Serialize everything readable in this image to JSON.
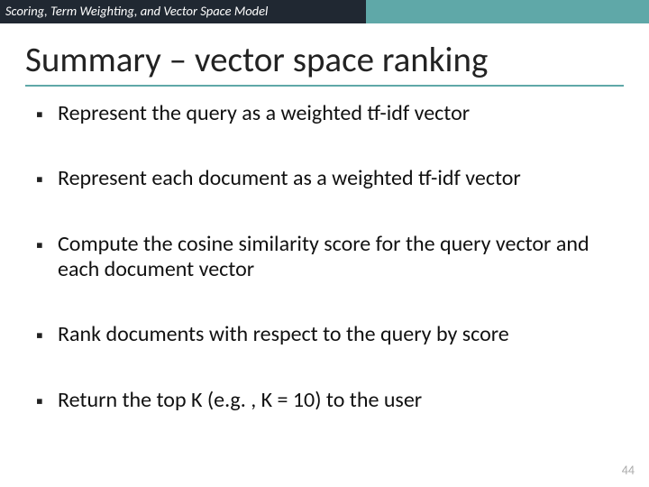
{
  "header": {
    "breadcrumb": "Scoring, Term Weighting, and Vector Space Model"
  },
  "title": "Summary – vector space ranking",
  "bullets": [
    "Represent the query as a weighted tf-idf vector",
    "Represent each document as a weighted tf-idf vector",
    "Compute the cosine similarity score for the query vector and each document vector",
    "Rank documents with respect to the query by score",
    "Return the top K (e.g. , K = 10) to the user"
  ],
  "page_number": "44"
}
